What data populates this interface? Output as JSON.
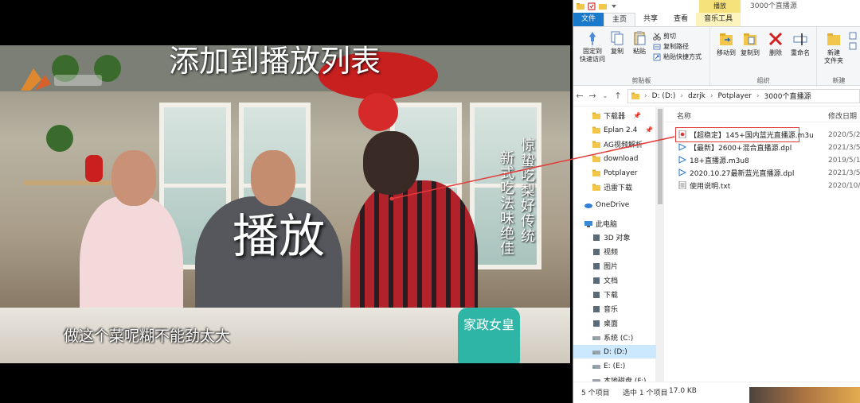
{
  "player": {
    "overlay_title": "添加到播放列表",
    "play_label": "播放",
    "subtitle": "做这个菜呢糊不能劲太大",
    "vertical_caption_1": "惊蛰吃梨好传统",
    "vertical_caption_2": "新式吃法味绝佳",
    "badge_text": "家政女皇"
  },
  "explorer": {
    "context_tab": "播放",
    "window_title": "3000个直播源",
    "tabs": [
      {
        "label": "文件",
        "kind": "file"
      },
      {
        "label": "主页",
        "kind": "active"
      },
      {
        "label": "共享",
        "kind": ""
      },
      {
        "label": "查看",
        "kind": ""
      },
      {
        "label": "音乐工具",
        "kind": "music"
      }
    ],
    "ribbon": {
      "clipboard": {
        "pin_label": "固定到\n快速访问",
        "copy_label": "复制",
        "paste_label": "粘贴",
        "cut_label": "剪切",
        "copy_path_label": "复制路径",
        "paste_shortcut_label": "粘贴快捷方式",
        "group_label": "剪贴板"
      },
      "organize": {
        "move_label": "移动到",
        "copy_to_label": "复制到",
        "delete_label": "删除",
        "rename_label": "重命名",
        "group_label": "组织"
      },
      "new": {
        "new_folder_label": "新建\n文件夹",
        "group_label": "新建"
      }
    },
    "address": {
      "crumbs": [
        "D: (D:)",
        "dzrjk",
        "Potplayer",
        "3000个直播源"
      ]
    },
    "nav_items": [
      {
        "label": "下载器",
        "pinned": true
      },
      {
        "label": "Eplan 2.4",
        "pinned": true
      },
      {
        "label": "AG视频解析",
        "pinned": false
      },
      {
        "label": "download",
        "pinned": false
      },
      {
        "label": "Potplayer",
        "pinned": false
      },
      {
        "label": "迅雷下载",
        "pinned": false
      },
      {
        "label": "OneDrive",
        "pinned": false
      },
      {
        "label": "此电脑",
        "pinned": false
      },
      {
        "label": "3D 对象",
        "pinned": false
      },
      {
        "label": "视频",
        "pinned": false
      },
      {
        "label": "图片",
        "pinned": false
      },
      {
        "label": "文档",
        "pinned": false
      },
      {
        "label": "下载",
        "pinned": false
      },
      {
        "label": "音乐",
        "pinned": false
      },
      {
        "label": "桌面",
        "pinned": false
      },
      {
        "label": "系统 (C:)",
        "pinned": false
      },
      {
        "label": "D: (D:)",
        "pinned": false
      },
      {
        "label": "E:   (E:)",
        "pinned": false
      },
      {
        "label": "本地磁盘 (F:)",
        "pinned": false
      }
    ],
    "columns": {
      "name": "名称",
      "date": "修改日期"
    },
    "files": [
      {
        "name": "【超稳定】145+国内蓝光直播源.m3u",
        "date": "2020/5/2",
        "type": "m3u"
      },
      {
        "name": "【最新】2600+混合直播源.dpl",
        "date": "2021/3/5",
        "type": "dpl"
      },
      {
        "name": "18+直播源.m3u8",
        "date": "2019/5/1",
        "type": "dpl"
      },
      {
        "name": "2020.10.27最新蓝光直播源.dpl",
        "date": "2021/3/5",
        "type": "dpl"
      },
      {
        "name": "使用说明.txt",
        "date": "2020/10/",
        "type": "txt"
      }
    ],
    "status": {
      "item_count": "5 个项目",
      "selection": "选中 1 个项目",
      "size": "17.0 KB"
    }
  },
  "colors": {
    "accent": "#1979ca",
    "highlight_box": "#e23b3b",
    "folder": "#f2c64b",
    "context_tab": "#f6e27a"
  }
}
